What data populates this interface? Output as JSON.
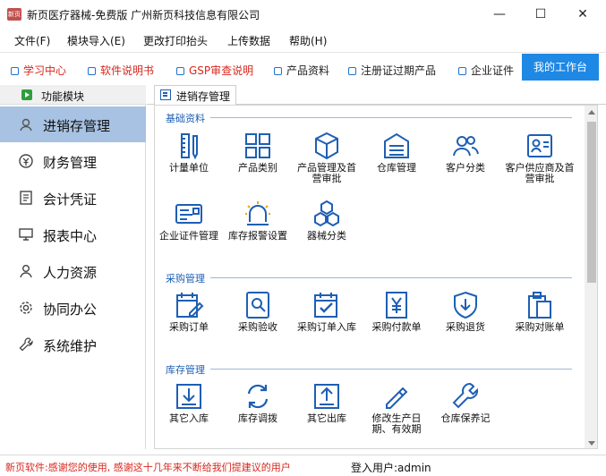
{
  "window": {
    "title": "新页医疗器械-免费版 广州新页科技信息有限公司",
    "logo_text": "新页",
    "controls": {
      "minimize": "—",
      "maximize": "☐",
      "close": "✕"
    }
  },
  "menu": [
    "文件(F)",
    "模块导入(E)",
    "更改打印抬头",
    "上传数据",
    "帮助(H)"
  ],
  "quicklinks": [
    {
      "label": "学习中心",
      "color": "#d9261c"
    },
    {
      "label": "软件说明书",
      "color": "#d9261c"
    },
    {
      "label": "GSP审查说明",
      "color": "#d9261c"
    },
    {
      "label": "产品资料",
      "color": "#222222"
    },
    {
      "label": "注册证过期产品",
      "color": "#222222"
    },
    {
      "label": "企业证件",
      "color": "#222222"
    }
  ],
  "workbench_button": "我的工作台",
  "sidebar": {
    "header": "功能模块",
    "items": [
      {
        "label": "进销存管理",
        "icon": "user-badge-icon",
        "active": true
      },
      {
        "label": "财务管理",
        "icon": "money-icon",
        "active": false
      },
      {
        "label": "会计凭证",
        "icon": "voucher-icon",
        "active": false
      },
      {
        "label": "报表中心",
        "icon": "monitor-icon",
        "active": false
      },
      {
        "label": "人力资源",
        "icon": "person-icon",
        "active": false
      },
      {
        "label": "协同办公",
        "icon": "gear-icon",
        "active": false
      },
      {
        "label": "系统维护",
        "icon": "wrench-icon",
        "active": false
      }
    ]
  },
  "tab": {
    "label": "进销存管理"
  },
  "sections": [
    {
      "title": "基础资料",
      "tiles": [
        {
          "label": "计量单位",
          "icon": "ruler-icon"
        },
        {
          "label": "产品类别",
          "icon": "grid-icon"
        },
        {
          "label": "产品管理及首营审批",
          "icon": "cube-icon"
        },
        {
          "label": "仓库管理",
          "icon": "warehouse-icon"
        },
        {
          "label": "客户分类",
          "icon": "users-icon"
        },
        {
          "label": "客户供应商及首营审批",
          "icon": "contact-card-icon"
        },
        {
          "label": "企业证件管理",
          "icon": "id-card-icon"
        },
        {
          "label": "库存报警设置",
          "icon": "alarm-icon"
        },
        {
          "label": "器械分类",
          "icon": "hexagons-icon"
        }
      ]
    },
    {
      "title": "采购管理",
      "tiles": [
        {
          "label": "采购订单",
          "icon": "calendar-edit-icon"
        },
        {
          "label": "采购验收",
          "icon": "search-doc-icon"
        },
        {
          "label": "采购订单入库",
          "icon": "calendar-check-icon"
        },
        {
          "label": "采购付款单",
          "icon": "yen-doc-icon"
        },
        {
          "label": "采购退货",
          "icon": "shield-down-icon"
        },
        {
          "label": "采购对账单",
          "icon": "clipboard-icon"
        }
      ]
    },
    {
      "title": "库存管理",
      "tiles": [
        {
          "label": "其它入库",
          "icon": "inbox-in-icon"
        },
        {
          "label": "库存调拨",
          "icon": "transfer-icon"
        },
        {
          "label": "其它出库",
          "icon": "inbox-out-icon"
        },
        {
          "label": "修改生产日期、有效期",
          "icon": "pencil-icon"
        },
        {
          "label": "仓库保养记",
          "icon": "wrench-tile-icon"
        }
      ]
    }
  ],
  "status": {
    "message": "新页软件:感谢您的使用, 感谢这十几年来不断给我们提建议的用户",
    "login": "登入用户:admin"
  },
  "colors": {
    "accent": "#1e88e5",
    "sidebar_active": "#a7c2e2",
    "alert_text": "#d9261c",
    "icon_blue": "#1e5fb4"
  }
}
